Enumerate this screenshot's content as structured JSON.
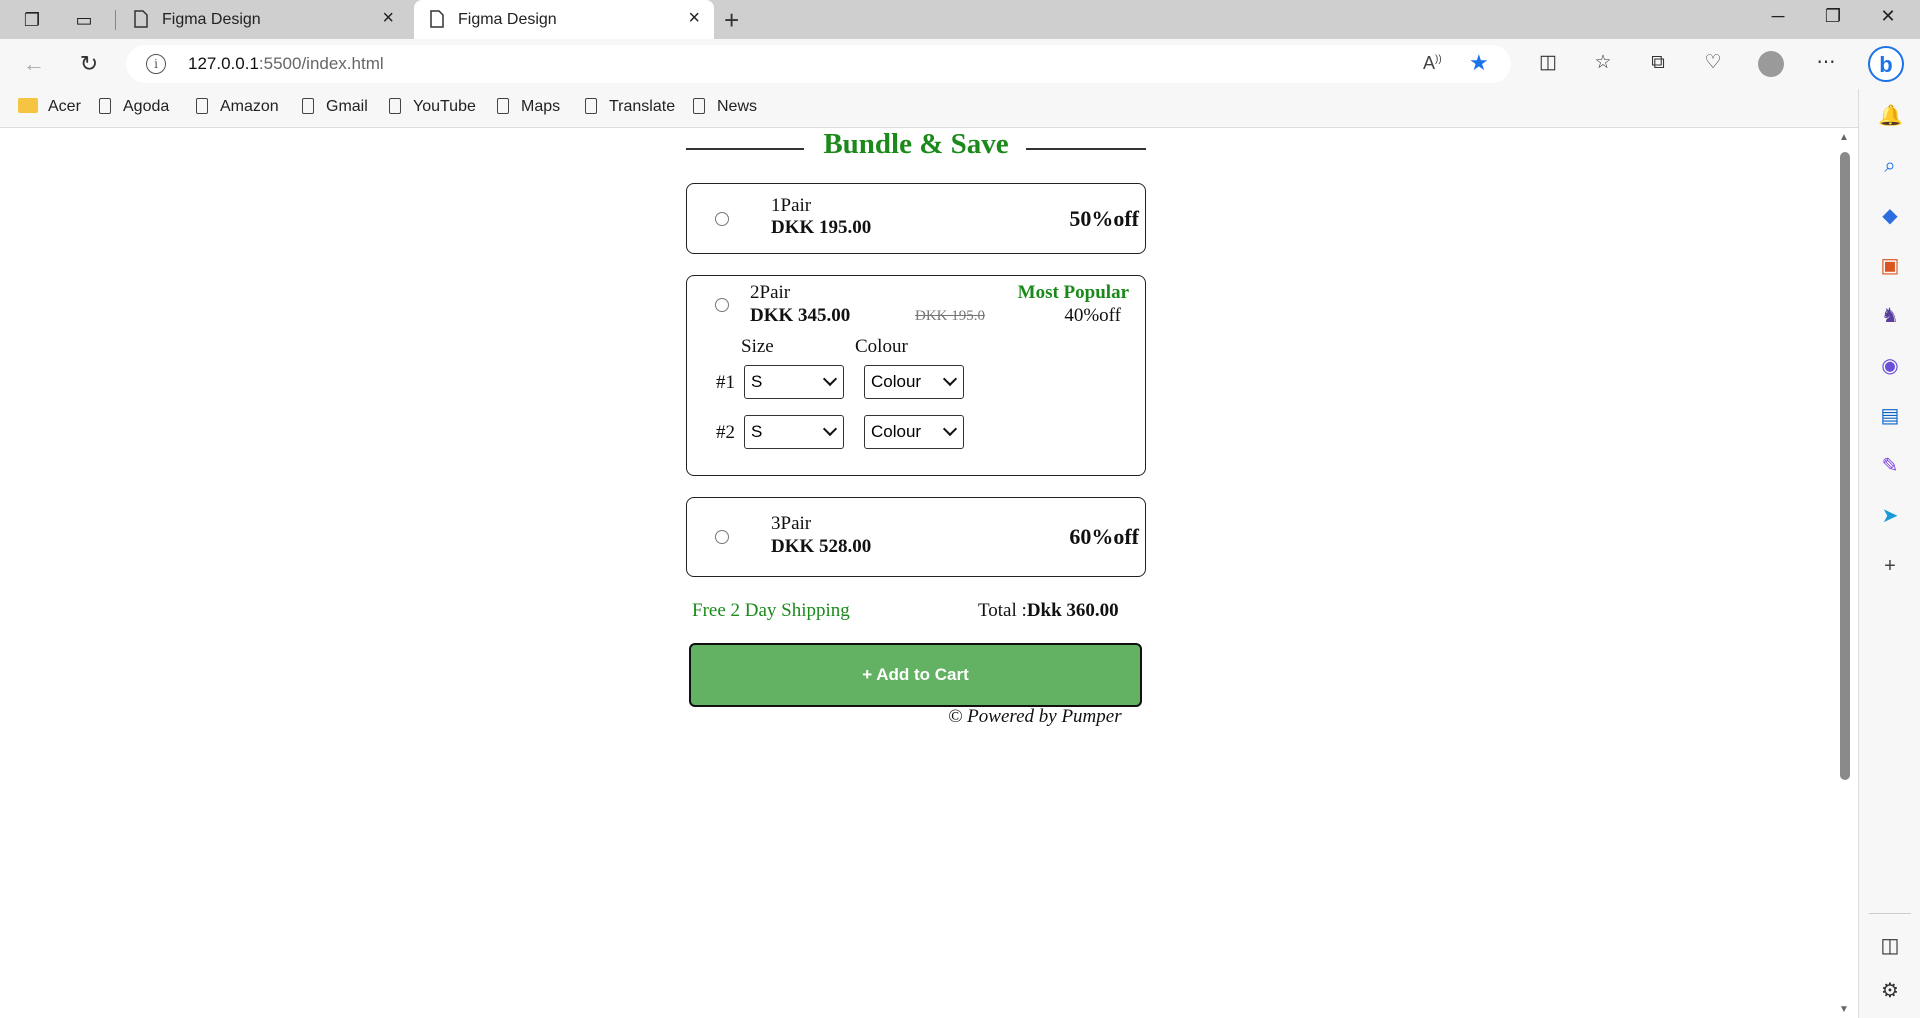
{
  "browser": {
    "tabs": [
      {
        "title": "Figma Design",
        "active": false
      },
      {
        "title": "Figma Design",
        "active": true
      }
    ],
    "url": {
      "host": "127.0.0.1",
      "rest": ":5500/index.html"
    },
    "bookmarks": [
      "Acer",
      "Agoda",
      "Amazon",
      "Gmail",
      "YouTube",
      "Maps",
      "Translate",
      "News"
    ],
    "accent_color": "#1a73e8"
  },
  "page": {
    "heading": "Bundle & Save",
    "options": [
      {
        "qty": "1Pair",
        "price": "DKK 195.00",
        "discount": "50%off"
      },
      {
        "qty": "2Pair",
        "price": "DKK 345.00",
        "old_price": "DKK 195.0",
        "badge": "Most Popular",
        "discount": "40%off",
        "size_label": "Size",
        "colour_label": "Colour",
        "rows": [
          {
            "label": "#1",
            "size": "S",
            "colour": "Colour"
          },
          {
            "label": "#2",
            "size": "S",
            "colour": "Colour"
          }
        ]
      },
      {
        "qty": "3Pair",
        "price": "DKK 528.00",
        "discount": "60%off"
      }
    ],
    "shipping": "Free 2 Day Shipping",
    "total_label": "Total :",
    "total_value": "Dkk 360.00",
    "add_to_cart": "+ Add to Cart",
    "powered_by": "© Powered by Pumper",
    "colors": {
      "green_text": "#1b8a1b",
      "button": "#63b163"
    }
  }
}
